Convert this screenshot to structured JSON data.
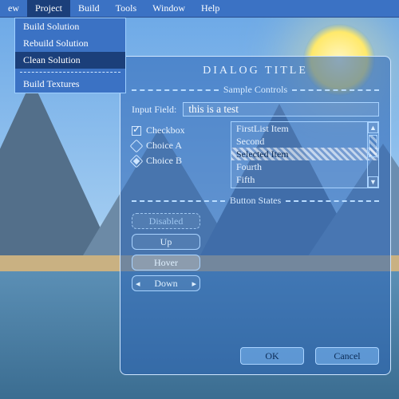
{
  "menubar": {
    "items": [
      {
        "label": "ew"
      },
      {
        "label": "Project"
      },
      {
        "label": "Build"
      },
      {
        "label": "Tools"
      },
      {
        "label": "Window"
      },
      {
        "label": "Help"
      }
    ],
    "open_index": 1,
    "dropdown": {
      "items": [
        "Build Solution",
        "Rebuild Solution",
        "Clean Solution"
      ],
      "highlight_index": 2,
      "items_after_sep": [
        "Build Textures"
      ]
    }
  },
  "dialog": {
    "title": "DIALOG TITLE",
    "group1": "Sample Controls",
    "input_label": "Input Field:",
    "input_value": "this is a test",
    "checkbox_label": "Checkbox",
    "radio_a": "Choice A",
    "radio_b": "Choice B",
    "list": {
      "items": [
        "FirstList Item",
        "Second",
        "Selected Item",
        "Fourth",
        "Fifth"
      ],
      "selected_index": 2
    },
    "group2": "Button States",
    "btn_disabled": "Disabled",
    "btn_up": "Up",
    "btn_hover": "Hover",
    "btn_down": "Down",
    "ok": "OK",
    "cancel": "Cancel"
  }
}
